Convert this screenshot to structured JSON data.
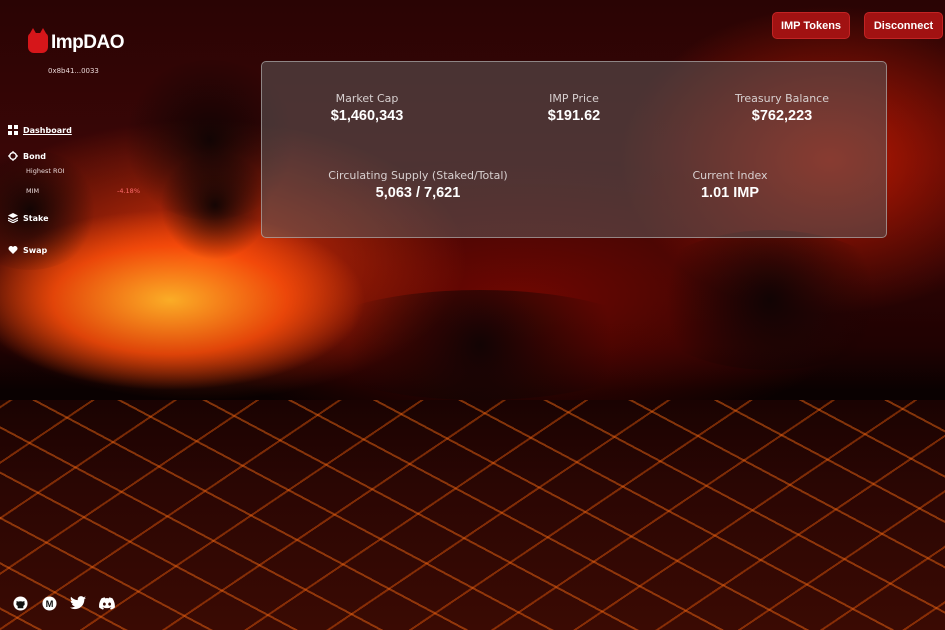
{
  "brand": {
    "name": "ImpDAO",
    "wallet_address": "0x8b41...0033"
  },
  "nav": {
    "dashboard": "Dashboard",
    "bond": "Bond",
    "bond_sub": [
      {
        "label": "Highest ROI",
        "value": ""
      },
      {
        "label": "MIM",
        "value": "-4.18%"
      }
    ],
    "stake": "Stake",
    "swap": "Swap"
  },
  "header": {
    "tokens_button": "IMP Tokens",
    "disconnect_button": "Disconnect"
  },
  "stats": {
    "market_cap": {
      "label": "Market Cap",
      "value": "$1,460,343"
    },
    "imp_price": {
      "label": "IMP Price",
      "value": "$191.62"
    },
    "treasury_balance": {
      "label": "Treasury Balance",
      "value": "$762,223"
    },
    "circulating_supply": {
      "label": "Circulating Supply (Staked/Total)",
      "value": "5,063 / 7,621"
    },
    "current_index": {
      "label": "Current Index",
      "value": "1.01 IMP"
    }
  },
  "socials": [
    "github-icon",
    "medium-icon",
    "twitter-icon",
    "discord-icon"
  ],
  "colors": {
    "accent": "#a11212",
    "negative": "#ff6a6a"
  }
}
